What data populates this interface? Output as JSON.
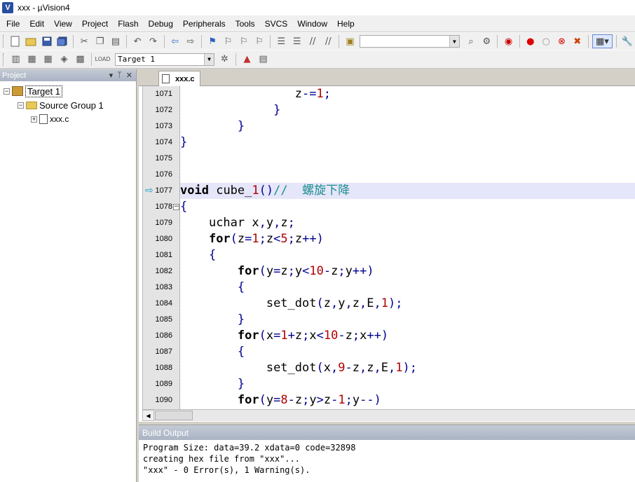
{
  "window": {
    "title": "xxx - µVision4"
  },
  "menu": [
    "File",
    "Edit",
    "View",
    "Project",
    "Flash",
    "Debug",
    "Peripherals",
    "Tools",
    "SVCS",
    "Window",
    "Help"
  ],
  "toolbar2": {
    "target_select": "Target 1"
  },
  "project": {
    "header": "Project",
    "tree": {
      "target": "Target 1",
      "group": "Source Group 1",
      "file": "xxx.c"
    }
  },
  "editor": {
    "tab": "xxx.c",
    "current_line": "1077",
    "lines": [
      {
        "n": "1071"
      },
      {
        "n": "1072"
      },
      {
        "n": "1073"
      },
      {
        "n": "1074"
      },
      {
        "n": "1075"
      },
      {
        "n": "1076"
      },
      {
        "n": "1077"
      },
      {
        "n": "1078"
      },
      {
        "n": "1079"
      },
      {
        "n": "1080"
      },
      {
        "n": "1081"
      },
      {
        "n": "1082"
      },
      {
        "n": "1083"
      },
      {
        "n": "1084"
      },
      {
        "n": "1085"
      },
      {
        "n": "1086"
      },
      {
        "n": "1087"
      },
      {
        "n": "1088"
      },
      {
        "n": "1089"
      },
      {
        "n": "1090"
      }
    ],
    "code": {
      "l1071": "z-=1;",
      "l1072": "}",
      "l1073": "}",
      "l1074": "}",
      "l1077_kw": "void",
      "l1077_fn": "cube_1",
      "l1077_paren": "()",
      "l1077_cmt": "//  螺旋下降",
      "l1078": "{",
      "l1079": "uchar x,y,z;",
      "l1080_kw": "for",
      "l1080_rest": "(z=1;z<5;z++)",
      "l1081": "{",
      "l1082_kw": "for",
      "l1082_rest": "(y=z;y<10-z;y++)",
      "l1083": "{",
      "l1084": "set_dot(z,y,z,E,1);",
      "l1085": "}",
      "l1086_kw": "for",
      "l1086_rest": "(x=1+z;x<10-z;x++)",
      "l1087": "{",
      "l1088": "set_dot(x,9-z,z,E,1);",
      "l1089": "}",
      "l1090_kw": "for",
      "l1090_rest": "(y=8-z;y>z-1;y--)"
    }
  },
  "build": {
    "header": "Build Output",
    "lines": [
      "Program Size: data=39.2 xdata=0 code=32898",
      "creating hex file from \"xxx\"...",
      "\"xxx\" - 0 Error(s), 1 Warning(s)."
    ]
  }
}
